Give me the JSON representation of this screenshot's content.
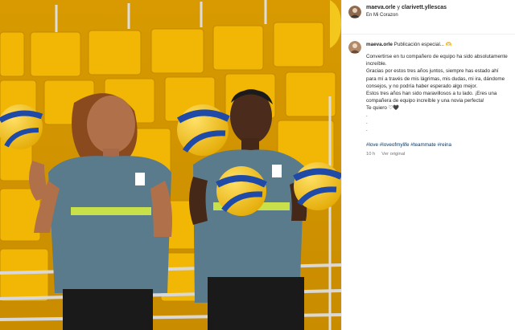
{
  "post": {
    "author": "maeva.orle",
    "connector": " y ",
    "collaborator": "clarivett.yllescas",
    "location": "En Mi Corazon"
  },
  "caption": {
    "author": "maeva.orle",
    "first_line": " Publicación especial... ",
    "first_line_emoji": "🫶",
    "paragraph1": "Convertirse en tu compañero de equipo ha sido absolutamente increíble.",
    "paragraph2": "Gracias por estos tres años juntos, siempre has estado ahí para mí a través de mis lágrimas, mis dudas, mi ira, dándome consejos, y no podría haber esperado algo mejor.",
    "paragraph3": "Estos tres años han sido maravillosos a tu lado. ¡Eres una compañera de equipo increíble y una novia perfecta!",
    "paragraph4": "Te quiero ♡🖤",
    "dot1": ".",
    "dot2": ".",
    "dot3": ".",
    "hashtags": "#love #loveofmylife #teammate #reina",
    "time": "10 h",
    "see_original": "Ver original"
  },
  "colors": {
    "seat_yellow": "#f2b705",
    "jersey": "#5a7b8c",
    "jersey_stripe": "#c8e04a",
    "ball_yellow": "#f3c71c",
    "ball_blue": "#1f4aa8",
    "hashtag": "#00376b"
  }
}
